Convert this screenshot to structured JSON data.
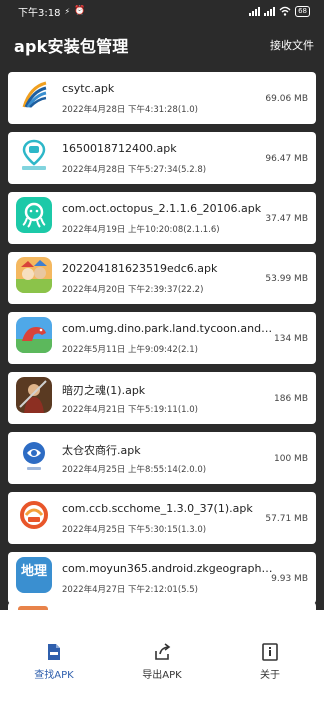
{
  "status_bar": {
    "time": "下午3:18",
    "battery": "68"
  },
  "header": {
    "title": "apk安装包管理",
    "receive_label": "接收文件"
  },
  "apps": [
    {
      "name": "csytc.apk",
      "date": "2022年4月28日 下午4:31:28(1.0)",
      "size": "69.06 MB",
      "icon": "feather-logo-icon"
    },
    {
      "name": "1650018712400.apk",
      "date": "2022年4月28日 下午5:27:34(5.2.8)",
      "size": "96.47 MB",
      "icon": "location-pin-app-icon"
    },
    {
      "name": "com.oct.octopus_2.1.1.6_20106.apk",
      "date": "2022年4月19日 上午10:20:08(2.1.1.6)",
      "size": "37.47 MB",
      "icon": "octopus-app-icon"
    },
    {
      "name": "202204181623519edc6.apk",
      "date": "2022年4月20日 下午2:39:37(22.2)",
      "size": "53.99 MB",
      "icon": "cartoon-game-icon"
    },
    {
      "name": "com.umg.dino.park.land.tycoon.androi...",
      "date": "2022年5月11日 上午9:09:42(2.1)",
      "size": "134 MB",
      "icon": "dinosaur-game-icon"
    },
    {
      "name": "暗刃之魂(1).apk",
      "date": "2022年4月21日 下午5:19:11(1.0)",
      "size": "186 MB",
      "icon": "warrior-game-icon"
    },
    {
      "name": "太仓农商行.apk",
      "date": "2022年4月25日 上午8:55:14(2.0.0)",
      "size": "100 MB",
      "icon": "bank-logo-icon"
    },
    {
      "name": "com.ccb.scchome_1.3.0_37(1).apk",
      "date": "2022年4月25日 下午5:30:15(1.3.0)",
      "size": "57.71 MB",
      "icon": "ccb-logo-icon"
    },
    {
      "name": "com.moyun365.android.zkgeography...",
      "date": "2022年4月27日 下午2:12:01(5.5)",
      "size": "9.93 MB",
      "icon": "geography-app-icon"
    }
  ],
  "geography_icon_text": "地理",
  "bottom_nav": [
    {
      "label": "查找APK",
      "icon": "apk-search-icon",
      "active": true
    },
    {
      "label": "导出APK",
      "icon": "export-icon",
      "active": false
    },
    {
      "label": "关于",
      "icon": "info-icon",
      "active": false
    }
  ],
  "colors": {
    "background": "#2b2b2b",
    "card": "#ffffff",
    "active_nav": "#2f5fad"
  }
}
